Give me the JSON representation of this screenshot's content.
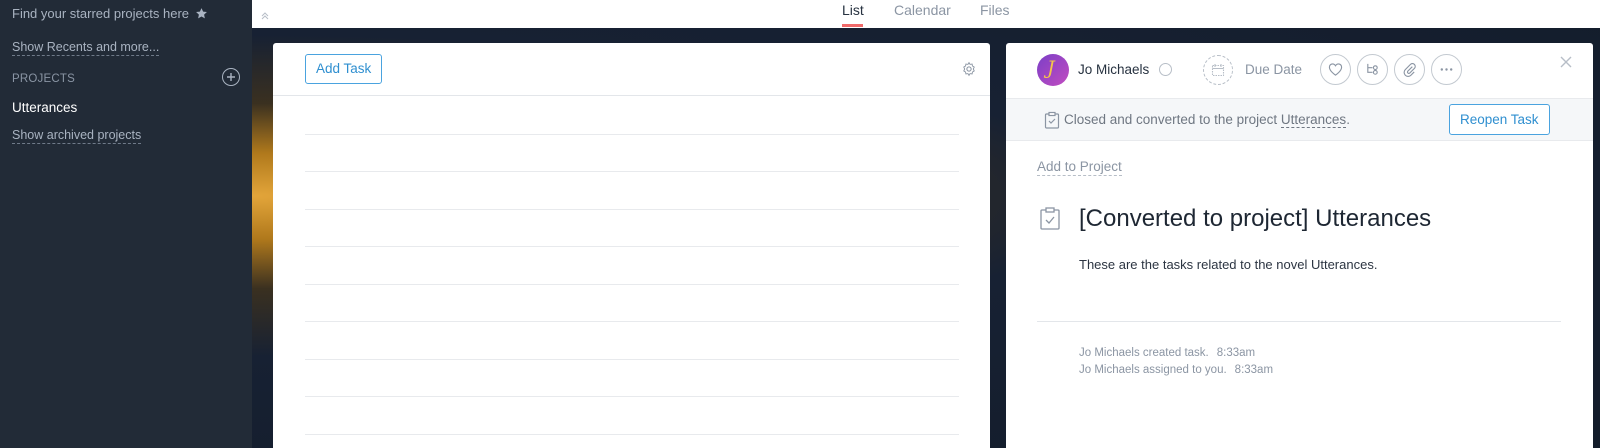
{
  "sidebar": {
    "starred_text": "Find your starred projects here",
    "recents_link": "Show Recents and more...",
    "projects_label": "PROJECTS",
    "project_name": "Utterances",
    "archived_link": "Show archived projects"
  },
  "tabs": {
    "list": "List",
    "calendar": "Calendar",
    "files": "Files"
  },
  "list_panel": {
    "add_task_label": "Add Task"
  },
  "detail": {
    "avatar_initial": "J",
    "assignee": "Jo Michaels",
    "due_label": "Due Date",
    "closed_text": "Closed and converted to the project",
    "closed_project_link": "Utterances",
    "closed_suffix": ".",
    "reopen_label": "Reopen Task",
    "add_to_project": "Add to Project",
    "title": "[Converted to project] Utterances",
    "description": "These are the tasks related to the novel Utterances.",
    "stories": [
      {
        "text": "Jo Michaels created task.",
        "time": "8:33am"
      },
      {
        "text": "Jo Michaels assigned to you.",
        "time": "8:33am"
      }
    ]
  },
  "colors": {
    "sidebar_bg": "#222b37",
    "accent_blue": "#2f8fd0",
    "tab_active_underline": "#f06a6a"
  }
}
